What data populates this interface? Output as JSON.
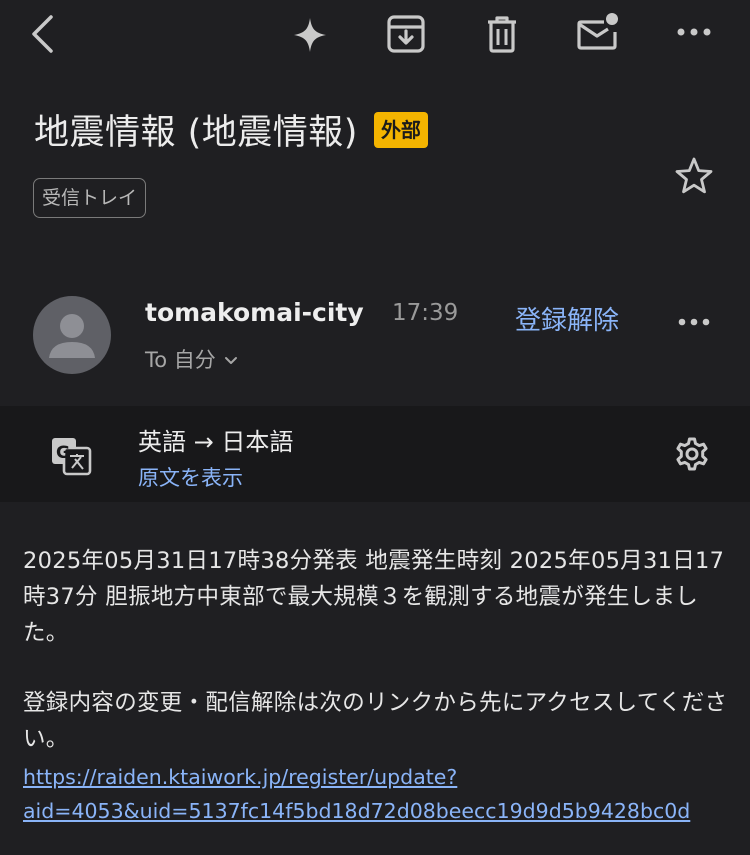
{
  "toolbar": {
    "icons": [
      "back-icon",
      "sparkle-icon",
      "archive-icon",
      "delete-icon",
      "mark-unread-icon",
      "more-icon"
    ]
  },
  "email": {
    "subject": "地震情報 (地震情報)",
    "external_badge": "外部",
    "label": "受信トレイ",
    "sender": {
      "name": "tomakomai-city",
      "time": "17:39",
      "unsubscribe": "登録解除",
      "recipient": "To 自分"
    },
    "translation": {
      "languages": "英語 → 日本語",
      "show_original": "原文を表示"
    },
    "body": {
      "paragraph1": "2025年05月31日17時38分発表 地震発生時刻 2025年05月31日17時37分 胆振地方中東部で最大規模３を観測する地震が発生しました。",
      "paragraph2": "登録内容の変更・配信解除は次のリンクから先にアクセスしてください。",
      "link_line1": "https://raiden.ktaiwork.jp/register/update?",
      "link_line2": "aid=4053&uid=5137fc14f5bd18d72d08beecc19d9d5b9428bc0d"
    }
  },
  "colors": {
    "background": "#1f1f22",
    "translate_bar": "#18181a",
    "link": "#8ab4f8",
    "badge": "#f4b400"
  }
}
